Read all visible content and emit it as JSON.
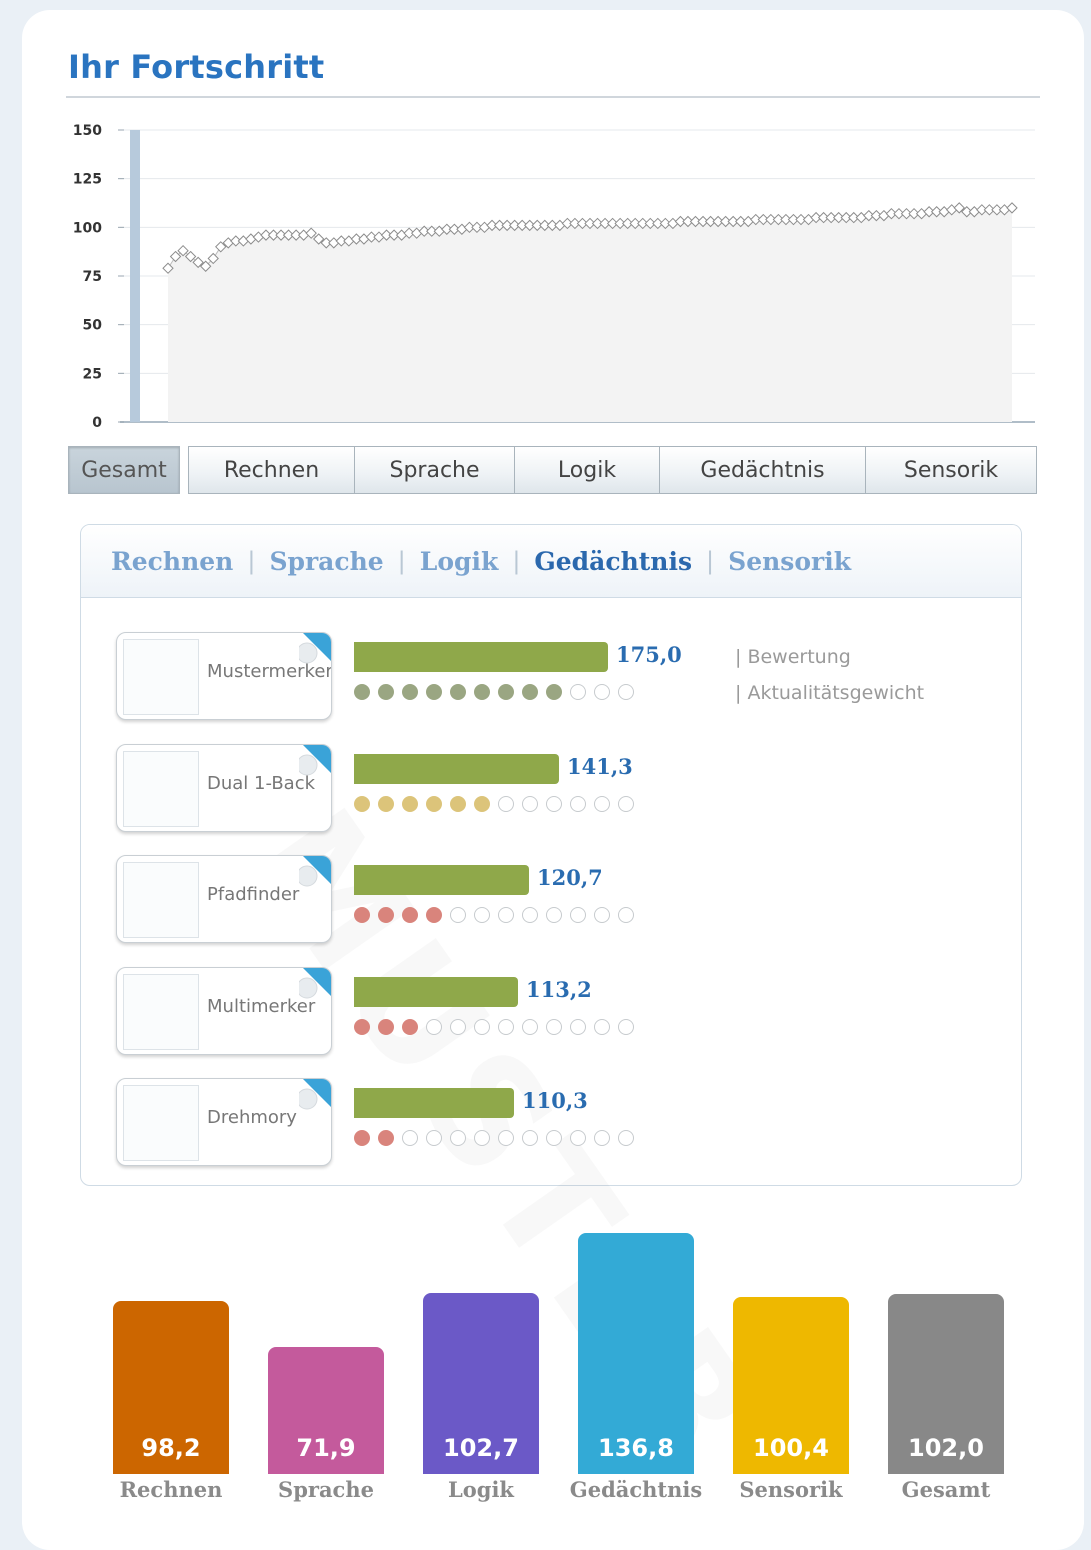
{
  "title": "Ihr Fortschritt",
  "chart_data": [
    {
      "type": "line",
      "ylim": [
        0,
        150
      ],
      "yticks": [
        "150",
        "125",
        "100",
        "75",
        "50",
        "25",
        "0"
      ],
      "grid": true,
      "y": [
        79,
        85,
        88,
        85,
        82,
        80,
        84,
        90,
        92,
        93,
        93,
        94,
        95,
        96,
        96,
        96,
        96,
        96,
        96,
        97,
        94,
        92,
        92,
        93,
        93,
        94,
        94,
        95,
        95,
        96,
        96,
        96,
        97,
        97,
        98,
        98,
        98,
        99,
        99,
        99,
        100,
        100,
        100,
        101,
        101,
        101,
        101,
        101,
        101,
        101,
        101,
        101,
        101,
        102,
        102,
        102,
        102,
        102,
        102,
        102,
        102,
        102,
        102,
        102,
        102,
        102,
        102,
        102,
        103,
        103,
        103,
        103,
        103,
        103,
        103,
        103,
        103,
        103,
        104,
        104,
        104,
        104,
        104,
        104,
        104,
        104,
        105,
        105,
        105,
        105,
        105,
        105,
        105,
        106,
        106,
        106,
        107,
        107,
        107,
        107,
        107,
        108,
        108,
        108,
        109,
        110,
        108,
        108,
        109,
        109,
        109,
        109,
        110
      ]
    },
    {
      "type": "bar",
      "categories": [
        "Rechnen",
        "Sprache",
        "Logik",
        "Gedächtnis",
        "Sensorik",
        "Gesamt"
      ],
      "values": [
        98.2,
        71.9,
        102.7,
        136.8,
        100.4,
        102.0
      ],
      "value_labels": [
        "98,2",
        "71,9",
        "102,7",
        "136,8",
        "100,4",
        "102,0"
      ],
      "colors": [
        "#cc6600",
        "#c45a9c",
        "#6b59c7",
        "#33aad6",
        "#eeb800",
        "#888888"
      ]
    }
  ],
  "tabs": [
    "Gesamt",
    "Rechnen",
    "Sprache",
    "Logik",
    "Gedächtnis",
    "Sensorik"
  ],
  "active_tab": "Gesamt",
  "panel": {
    "tabs": [
      "Rechnen",
      "Sprache",
      "Logik",
      "Gedächtnis",
      "Sensorik"
    ],
    "active_tab": "Gedächtnis",
    "watermark": "MUSTER",
    "legend": [
      "| Bewertung",
      "| Aktualitätsgewicht"
    ],
    "games": [
      {
        "name": "Mustermerker",
        "score": "175,0",
        "value": 175.0,
        "filled": 9,
        "dot_color": "#9aa682"
      },
      {
        "name": "Dual 1-Back",
        "score": "141,3",
        "value": 141.3,
        "filled": 6,
        "dot_color": "#dcc47a"
      },
      {
        "name": "Pfadfinder",
        "score": "120,7",
        "value": 120.7,
        "filled": 4,
        "dot_color": "#d9847c"
      },
      {
        "name": "Multimerker",
        "score": "113,2",
        "value": 113.2,
        "filled": 3,
        "dot_color": "#d9847c"
      },
      {
        "name": "Drehmory",
        "score": "110,3",
        "value": 110.3,
        "filled": 2,
        "dot_color": "#d9847c"
      }
    ],
    "total_dots": 12
  },
  "colors": {
    "accent": "#2a74c0",
    "score_bar": "#8fa84a"
  }
}
